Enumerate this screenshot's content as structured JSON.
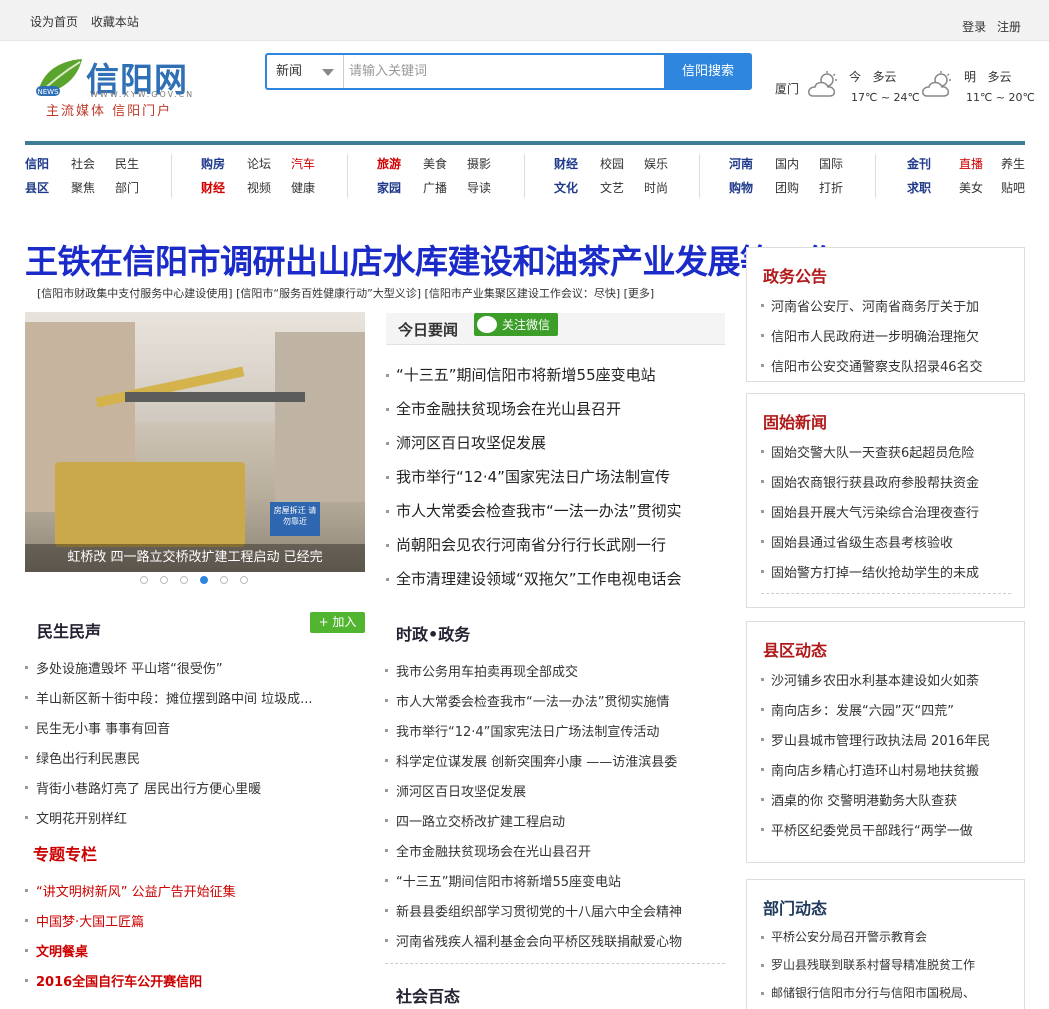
{
  "topbar": {
    "set_home": "设为首页",
    "bookmark": "收藏本站",
    "login": "登录",
    "register": "注册"
  },
  "logo": {
    "brand": "信阳网",
    "domain": "WWW.XYW.GOV.CN",
    "badge": "NEWS",
    "slogan": "主流媒体 信阳门户"
  },
  "search": {
    "category": "新闻",
    "placeholder": "请输入关键词",
    "button": "信阳搜索"
  },
  "weather": {
    "city": "厦门",
    "today": {
      "label": "今",
      "condition": "多云",
      "temp": "17℃ ~ 24℃"
    },
    "tomorrow": {
      "label": "明",
      "condition": "多云",
      "temp": "11℃ ~ 20℃"
    }
  },
  "nav": {
    "groups": [
      {
        "row1": [
          "信阳",
          "社会",
          "民生"
        ],
        "row2": [
          "县区",
          "聚焦",
          "部门"
        ]
      },
      {
        "row1": [
          "购房",
          "论坛",
          "汽车"
        ],
        "row2": [
          "财经",
          "视频",
          "健康"
        ]
      },
      {
        "row1": [
          "旅游",
          "美食",
          "摄影"
        ],
        "row2": [
          "家园",
          "广播",
          "导读"
        ]
      },
      {
        "row1": [
          "财经",
          "校园",
          "娱乐"
        ],
        "row2": [
          "文化",
          "文艺",
          "时尚"
        ]
      },
      {
        "row1": [
          "河南",
          "国内",
          "国际"
        ],
        "row2": [
          "购物",
          "团购",
          "打折"
        ]
      },
      {
        "row1": [
          "金刊",
          "直播",
          "养生"
        ],
        "row2": [
          "求职",
          "美女",
          "贴吧"
        ]
      }
    ],
    "colors": {
      "blue": "#1f3a8a",
      "red": "#d00000"
    }
  },
  "headline": {
    "title": "王铁在信阳市调研出山店水库建设和油茶产业发展等工作",
    "sublinks": "[信阳市财政集中支付服务中心建设使用] [信阳市“服务百姓健康行动”大型义诊] [信阳市产业集聚区建设工作会议：尽快] [更多]"
  },
  "slideshow": {
    "caption": "虹桥改 四一路立交桥改扩建工程启动 已经完",
    "sign_text": "房屋拆迁 请勿靠近",
    "active_index": 3,
    "count": 6
  },
  "today": {
    "title": "今日要闻",
    "wechat": "关注微信",
    "items": [
      "“十三五”期间信阳市将新增55座变电站",
      "全市金融扶贫现场会在光山县召开",
      "浉河区百日攻坚促发展",
      "我市举行“12·4”国家宪法日广场法制宣传",
      "市人大常委会检查我市“一法一办法”贯彻实",
      "尚朝阳会见农行河南省分行行长武刚一行",
      "全市清理建设领域“双拖欠”工作电视电话会"
    ]
  },
  "minsheng": {
    "title": "民生民声",
    "join": "+ 加入",
    "items": [
      "多处设施遭毁坏 平山塔“很受伤”",
      "羊山新区新十街中段：摊位摆到路中间 垃圾成...",
      "民生无小事 事事有回音",
      "绿色出行利民惠民",
      "背街小巷路灯亮了 居民出行方便心里暖",
      "文明花开别样红"
    ]
  },
  "special": {
    "title": "专题专栏",
    "items": [
      "“讲文明树新风” 公益广告开始征集",
      "中国梦·大国工匠篇",
      "文明餐桌",
      "2016全国自行车公开赛信阳"
    ]
  },
  "politics": {
    "title": "时政•政务",
    "items": [
      "我市公务用车拍卖再现全部成交",
      "市人大常委会检查我市“一法一办法”贯彻实施情",
      "我市举行“12·4”国家宪法日广场法制宣传活动",
      "科学定位谋发展 创新突围奔小康 ——访淮滨县委",
      "浉河区百日攻坚促发展",
      "四一路立交桥改扩建工程启动",
      "全市金融扶贫现场会在光山县召开",
      "“十三五”期间信阳市将新增55座变电站",
      "新县县委组织部学习贯彻党的十八届六中全会精神",
      "河南省残疾人福利基金会向平桥区残联捐献爱心物"
    ]
  },
  "society": {
    "title": "社会百态"
  },
  "gov_notice": {
    "title": "政务公告",
    "items": [
      "河南省公安厅、河南省商务厅关于加",
      "信阳市人民政府进一步明确治理拖欠",
      "信阳市公安交通警察支队招录46名交"
    ]
  },
  "gushi": {
    "title": "固始新闻",
    "items": [
      "固始交警大队一天查获6起超员危险",
      "固始农商银行获县政府参股帮扶资金",
      "固始县开展大气污染综合治理夜查行",
      "固始县通过省级生态县考核验收",
      "固始警方打掉一结伙抢劫学生的未成"
    ]
  },
  "county": {
    "title": "县区动态",
    "items": [
      "沙河铺乡农田水利基本建设如火如荼",
      "南向店乡：发展“六园”灭“四荒”",
      "罗山县城市管理行政执法局 2016年民",
      "南向店乡精心打造环山村易地扶贫搬",
      "酒桌的你 交警明港勤务大队查获",
      "平桥区纪委党员干部践行“两学一做"
    ]
  },
  "dept": {
    "title": "部门动态",
    "items": [
      "平桥公安分局召开警示教育会",
      "罗山县残联到联系村督导精准脱贫工作",
      "邮储银行信阳市分行与信阳市国税局、"
    ]
  }
}
